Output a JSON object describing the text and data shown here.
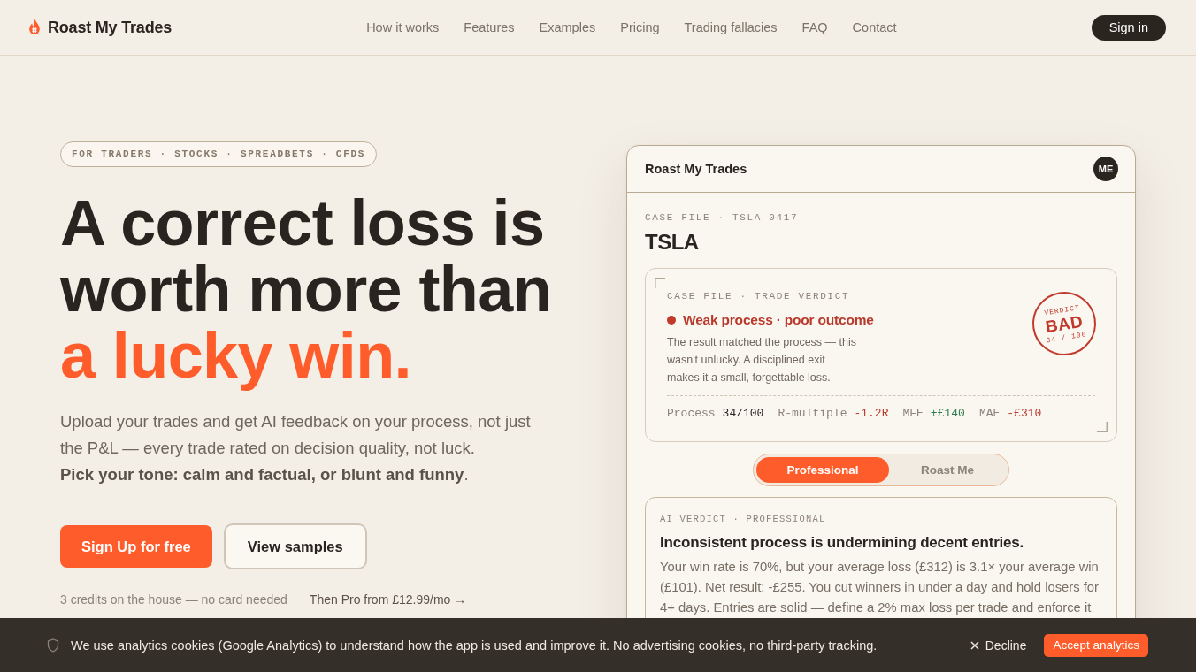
{
  "header": {
    "brand": "Roast My Trades",
    "nav": [
      "How it works",
      "Features",
      "Examples",
      "Pricing",
      "Trading fallacies",
      "FAQ",
      "Contact"
    ],
    "sign_in": "Sign in"
  },
  "hero": {
    "tag": "FOR TRADERS · STOCKS · SPREADBETS · CFDS",
    "headline": "A correct loss is worth more than",
    "headline_accent": "a lucky win.",
    "subtitle": "Upload your trades and get AI feedback on your process, not just the P&L — every trade rated on decision quality, not luck.",
    "tone_line": "**Pick your tone: calm and factual, or blunt and funny**.",
    "primary_button": "Sign Up for free",
    "secondary_button": "View samples",
    "note": "3 credits on the house — no card needed",
    "pricing_link": "Then Pro from £12.99/mo →"
  },
  "preview": {
    "app_title": "Roast My Trades",
    "avatar": "ME",
    "case_label": "CASE FILE · TSLA-0417",
    "ticker": "TSLA",
    "verdict_card": {
      "label": "CASE FILE · TRADE VERDICT",
      "status": "Weak process · poor outcome",
      "description": "The result matched the process — this wasn't unlucky. A disciplined exit makes it a small, forgettable loss.",
      "stamp": {
        "label": "VERDICT",
        "grade": "BAD",
        "score": "34 / 100"
      },
      "stats": [
        {
          "label": "Process",
          "value": "34/100",
          "color": "#2a2420"
        },
        {
          "label": "R-multiple",
          "value": "-1.2R",
          "color": "#b83a2c"
        },
        {
          "label": "MFE",
          "value": "+£140",
          "color": "#2f7d4e"
        },
        {
          "label": "MAE",
          "value": "-£310",
          "color": "#b83a2c"
        }
      ]
    },
    "tone_tabs": [
      {
        "label": "Professional",
        "selected": true
      },
      {
        "label": "Roast Me",
        "selected": false
      }
    ],
    "ai_verdict": {
      "label": "AI VERDICT · PROFESSIONAL",
      "title": "Inconsistent process is undermining decent entries.",
      "body": "Your win rate is 70%, but your average loss (£312) is 3.1× your average win (£101). Net result: -£255. You cut winners in under a day and hold losers for 4+ days. Entries are solid — define a 2% max loss per trade and enforce it"
    }
  },
  "cookie_banner": {
    "message": "We use analytics cookies (Google Analytics) to understand how the app is used and improve it. No advertising cookies, no third-party tracking.",
    "decline": "Decline",
    "accept": "Accept analytics"
  }
}
